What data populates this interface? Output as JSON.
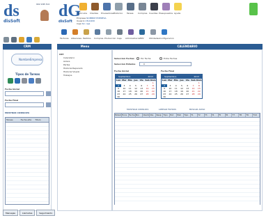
{
  "header": {
    "app_logo": "ds",
    "app_sub": "disSoft",
    "phone": "902 208 314",
    "company_logo": "dG",
    "company_sub": "disSoft",
    "fields": [
      {
        "label": "Empresa",
        "value": "NOMBRE EMPRESA"
      },
      {
        "label": "Usuario",
        "value": "USUARIO"
      },
      {
        "label": "Caja",
        "value": "Sin caja"
      }
    ],
    "top_nav": [
      "Articulos",
      "Clientes",
      "Proveedores",
      "Historico",
      "Tareas",
      "Compras",
      "Cuentas",
      "Presupuestos",
      "Ayuda"
    ],
    "second_nav": [
      "Facturas",
      "Albaranes",
      "Pedidos",
      "Compras",
      "Produccion",
      "Caja",
      "Administracion",
      "TPV",
      "Utilidades",
      "Configuracion"
    ]
  },
  "left": {
    "title": "CRM",
    "brand_button": "NombreEmpresa",
    "section": "Tipos de Tareas",
    "start_label": "Fecha Inicial",
    "end_label": "Fecha Final",
    "mode": "MOSTRAR CONSULTA",
    "columns": [
      "Tareas",
      "Fecha alta",
      "Titulo"
    ]
  },
  "menu": {
    "title": "Menu",
    "root": "CRT",
    "items": [
      "Calendario",
      "Avisos",
      "Partes",
      "Historial Reparado",
      "Historial Visado",
      "Trabajos"
    ]
  },
  "right": {
    "title": "CALENDARIO",
    "from_label": "Seleccion Fechas",
    "by_date": "Por Fecha",
    "between": "Entre Fechas",
    "filter_label": "Seleccion Estados",
    "filter_value": "0",
    "start_label": "Fecha Inicial",
    "end_label": "Fecha Final",
    "month": "Septiembre",
    "year": "2013",
    "days": [
      "Lun",
      "Mar",
      "Mie",
      "Jue",
      "Vie",
      "Sab",
      "Dom"
    ],
    "dates": [
      "",
      "",
      "",
      "",
      "",
      "",
      "1",
      "2",
      "3",
      "4",
      "5",
      "6",
      "7",
      "8",
      "9",
      "10",
      "11",
      "12",
      "13",
      "14",
      "15",
      "16",
      "17",
      "18",
      "19",
      "20",
      "21",
      "22",
      "23",
      "24",
      "25",
      "26",
      "27",
      "28",
      "29",
      "30",
      "",
      "",
      "",
      ""
    ],
    "actions": [
      "MOSTRAR CONSULTA",
      "LIMPIAR FILTROS",
      "BUSCAR AVISO"
    ],
    "grid_cols": [
      "Estado",
      "Hora",
      "Fecha",
      "Nro",
      "Cliente",
      "Obs",
      "Resp",
      "Tipo",
      "Est",
      "Mat",
      "Tipo",
      "T1",
      "T2",
      "T3",
      "T4",
      "T5",
      "T6",
      "T7",
      "T8",
      "T9",
      "T10"
    ]
  },
  "footer_tabs": [
    "Mensajes",
    "Llamadas",
    "Seguimiento"
  ]
}
